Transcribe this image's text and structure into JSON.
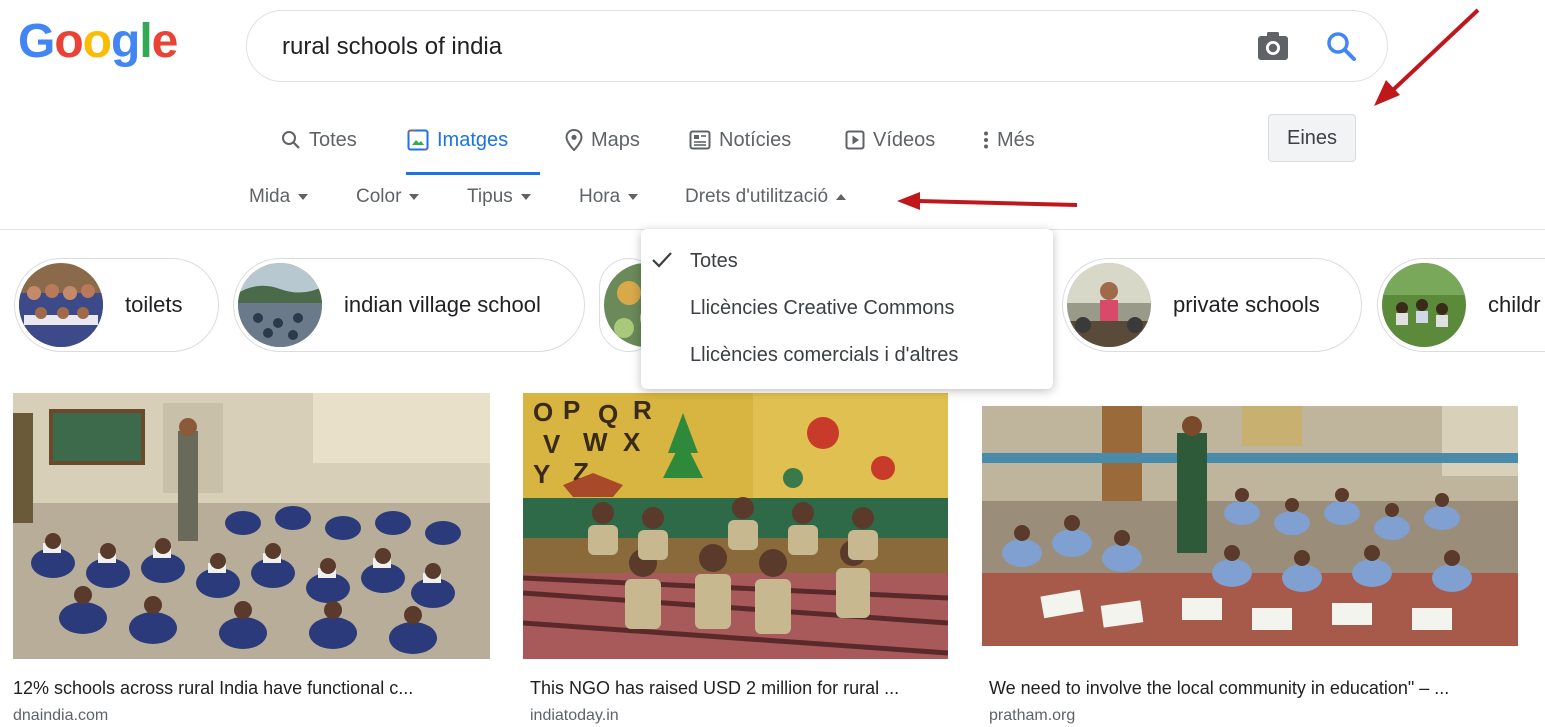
{
  "logo": {
    "letters": [
      "G",
      "o",
      "o",
      "g",
      "l",
      "e"
    ],
    "colors": [
      "#4285F4",
      "#EA4335",
      "#FBBC05",
      "#4285F4",
      "#34A853",
      "#EA4335"
    ]
  },
  "search": {
    "value": "rural schools of india"
  },
  "tabs": [
    {
      "label": "Totes",
      "icon": "search-icon"
    },
    {
      "label": "Imatges",
      "icon": "image-icon",
      "active": true
    },
    {
      "label": "Maps",
      "icon": "map-pin-icon"
    },
    {
      "label": "Notícies",
      "icon": "news-icon"
    },
    {
      "label": "Vídeos",
      "icon": "play-icon"
    },
    {
      "label": "Més",
      "icon": "more-vert-icon"
    }
  ],
  "tools_label": "Eines",
  "filters": [
    {
      "label": "Mida"
    },
    {
      "label": "Color"
    },
    {
      "label": "Tipus"
    },
    {
      "label": "Hora"
    },
    {
      "label": "Drets d'utilització",
      "open": true
    }
  ],
  "chips": [
    {
      "label": "toilets"
    },
    {
      "label": "indian village school"
    },
    {
      "label": "private schools"
    },
    {
      "label": "childr"
    }
  ],
  "usage_rights_menu": {
    "items": [
      {
        "label": "Totes",
        "checked": true
      },
      {
        "label": "Llicències Creative Commons"
      },
      {
        "label": "Llicències comercials i d'altres"
      }
    ]
  },
  "results": [
    {
      "title": "12% schools across rural India have functional c...",
      "source": "dnaindia.com"
    },
    {
      "title": "This NGO has raised USD 2 million for rural ...",
      "source": "indiatoday.in"
    },
    {
      "title": "We need to involve the local community in education\" – ...",
      "source": "pratham.org"
    }
  ],
  "colors": {
    "accent": "#1a73e8",
    "annotation_arrow": "#c0171c"
  }
}
